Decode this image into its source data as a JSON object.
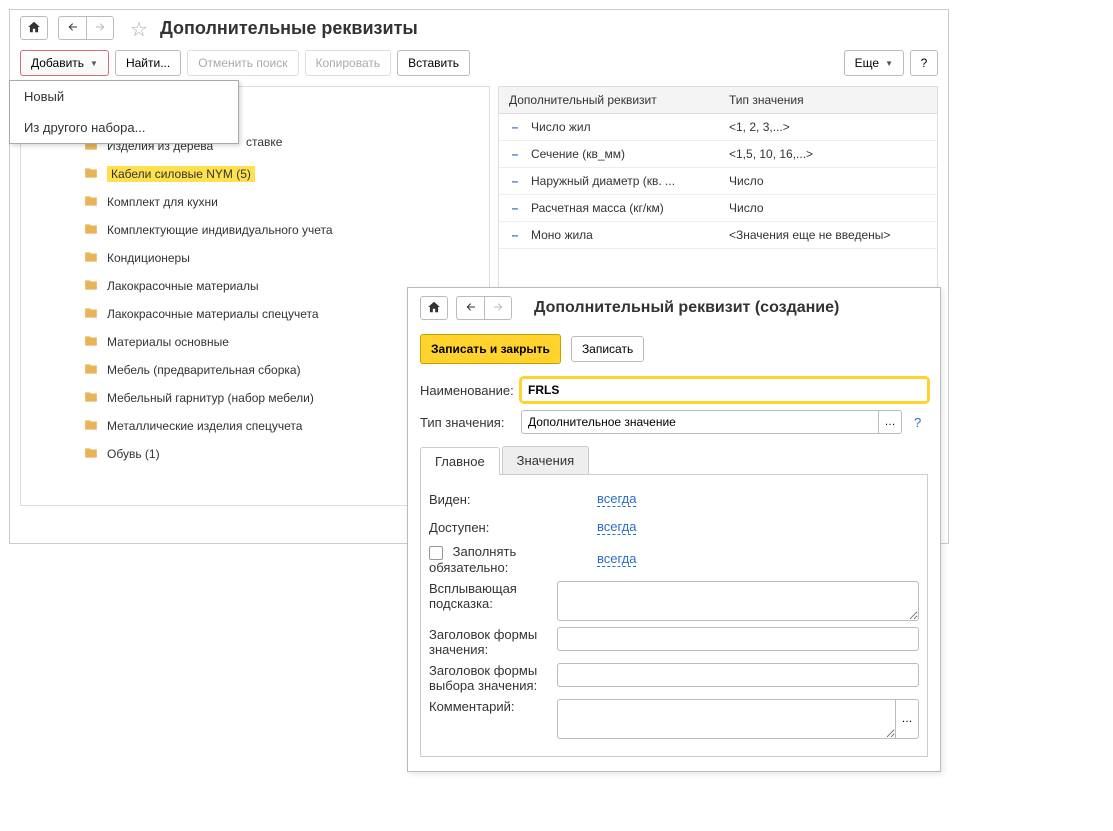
{
  "main": {
    "title": "Дополнительные реквизиты",
    "toolbar": {
      "add": "Добавить",
      "find": "Найти...",
      "cancel_search": "Отменить поиск",
      "copy": "Копировать",
      "paste": "Вставить",
      "more": "Еще",
      "help": "?"
    },
    "dropdown": {
      "new": "Новый",
      "from_other": "Из другого набора..."
    },
    "tree_partial": "ставке",
    "tree": [
      "Изделия из дерева",
      "Кабели силовые NYM (5)",
      "Комплект для кухни",
      "Комплектующие индивидуального учета",
      "Кондиционеры",
      "Лакокрасочные материалы",
      "Лакокрасочные материалы спецучета",
      "Материалы основные",
      "Мебель (предварительная сборка)",
      "Мебельный гарнитур (набор мебели)",
      "Металлические изделия спецучета",
      "Обувь (1)"
    ],
    "tree_selected_index": 1,
    "table": {
      "col1": "Дополнительный реквизит",
      "col2": "Тип значения",
      "rows": [
        {
          "name": "Число жил",
          "type": "<1, 2, 3,...>"
        },
        {
          "name": "Сечение (кв_мм)",
          "type": "<1,5, 10, 16,...>"
        },
        {
          "name": "Наружный диаметр (кв. ...",
          "type": "Число"
        },
        {
          "name": "Расчетная масса (кг/км)",
          "type": "Число"
        },
        {
          "name": "Моно жила",
          "type": "<Значения еще не введены>"
        }
      ]
    }
  },
  "dialog": {
    "title": "Дополнительный реквизит (создание)",
    "save_close": "Записать и закрыть",
    "save": "Записать",
    "name_label": "Наименование:",
    "name_value": "FRLS",
    "type_label": "Тип значения:",
    "type_value": "Дополнительное значение",
    "tabs": {
      "main": "Главное",
      "values": "Значения"
    },
    "props": {
      "visible": "Виден:",
      "available": "Доступен:",
      "required": "Заполнять обязательно:",
      "link": "всегда",
      "tooltip": "Всплывающая подсказка:",
      "form_header": "Заголовок формы значения:",
      "choice_header": "Заголовок формы выбора значения:",
      "comment": "Комментарий:"
    }
  }
}
